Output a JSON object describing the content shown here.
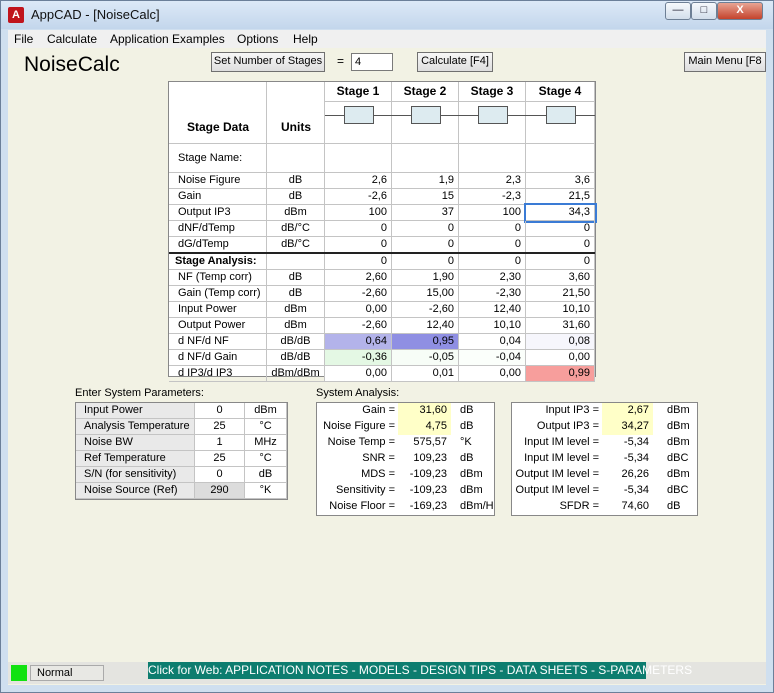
{
  "window": {
    "title": "AppCAD - [NoiseCalc]",
    "minimize": "—",
    "maximize": "□",
    "close": "X"
  },
  "menu": [
    "File",
    "Calculate",
    "Application Examples",
    "Options",
    "Help"
  ],
  "app": {
    "title": "NoiseCalc",
    "set_stages_label": "Set Number of Stages",
    "equals": "=",
    "stages_value": "4",
    "calculate_label": "Calculate [F4]",
    "main_menu_label": "Main Menu [F8"
  },
  "table": {
    "header_label": "Stage Data",
    "units_header": "Units",
    "stages": [
      "Stage  1",
      "Stage  2",
      "Stage  3",
      "Stage  4"
    ],
    "stage_name_label": "Stage Name:",
    "input_rows": [
      {
        "label": "Noise Figure",
        "unit": "dB",
        "values": [
          "2,6",
          "1,9",
          "2,3",
          "3,6"
        ]
      },
      {
        "label": "Gain",
        "unit": "dB",
        "values": [
          "-2,6",
          "15",
          "-2,3",
          "21,5"
        ]
      },
      {
        "label": "Output IP3",
        "unit": "dBm",
        "values": [
          "100",
          "37",
          "100",
          "34,3"
        ]
      },
      {
        "label": "dNF/dTemp",
        "unit": "dB/°C",
        "values": [
          "0",
          "0",
          "0",
          "0"
        ]
      },
      {
        "label": "dG/dTemp",
        "unit": "dB/°C",
        "values": [
          "0",
          "0",
          "0",
          "0"
        ]
      }
    ],
    "analysis_label": "Stage Analysis:",
    "analysis_values": [
      "0",
      "0",
      "0",
      "0"
    ],
    "analysis_rows": [
      {
        "label": "NF (Temp corr)",
        "unit": "dB",
        "values": [
          "2,60",
          "1,90",
          "2,30",
          "3,60"
        ]
      },
      {
        "label": "Gain (Temp corr)",
        "unit": "dB",
        "values": [
          "-2,60",
          "15,00",
          "-2,30",
          "21,50"
        ]
      },
      {
        "label": "Input Power",
        "unit": "dBm",
        "values": [
          "0,00",
          "-2,60",
          "12,40",
          "10,10"
        ]
      },
      {
        "label": "Output Power",
        "unit": "dBm",
        "values": [
          "-2,60",
          "12,40",
          "10,10",
          "31,60"
        ]
      },
      {
        "label": "d NF/d NF",
        "unit": "dB/dB",
        "values": [
          "0,64",
          "0,95",
          "0,04",
          "0,08"
        ]
      },
      {
        "label": "d NF/d Gain",
        "unit": "dB/dB",
        "values": [
          "-0,36",
          "-0,05",
          "-0,04",
          "0,00"
        ]
      },
      {
        "label": "d IP3/d IP3",
        "unit": "dBm/dBm",
        "values": [
          "0,00",
          "0,01",
          "0,00",
          "0,99"
        ]
      }
    ],
    "colors": {
      "nf_nf": [
        "#b3b3ea",
        "#8f8fe3",
        "#ffffff",
        "#f6f6fc"
      ],
      "nf_gain": [
        "#e4f8e4",
        "#f7fdf7",
        "#fbfffb",
        "#ffffff"
      ],
      "ip3": [
        "#ffffff",
        "#ffffff",
        "#ffffff",
        "#f79e9c"
      ]
    }
  },
  "system_params": {
    "title": "Enter System Parameters:",
    "rows": [
      {
        "label": "Input Power",
        "value": "0",
        "unit": "dBm"
      },
      {
        "label": "Analysis Temperature",
        "value": "25",
        "unit": "°C"
      },
      {
        "label": "Noise BW",
        "value": "1",
        "unit": "MHz"
      },
      {
        "label": "Ref Temperature",
        "value": "25",
        "unit": "°C"
      },
      {
        "label": "S/N (for sensitivity)",
        "value": "0",
        "unit": "dB"
      },
      {
        "label": "Noise Source (Ref)",
        "value": "290",
        "unit": "°K"
      }
    ]
  },
  "system_analysis": {
    "title": "System Analysis:",
    "left_rows": [
      {
        "label": "Gain =",
        "value": "31,60",
        "unit": "dB"
      },
      {
        "label": "Noise Figure =",
        "value": "4,75",
        "unit": "dB"
      },
      {
        "label": "Noise Temp =",
        "value": "575,57",
        "unit": "°K"
      },
      {
        "label": "SNR =",
        "value": "109,23",
        "unit": "dB"
      },
      {
        "label": "MDS =",
        "value": "-109,23",
        "unit": "dBm"
      },
      {
        "label": "Sensitivity =",
        "value": "-109,23",
        "unit": "dBm"
      },
      {
        "label": "Noise Floor =",
        "value": "-169,23",
        "unit": "dBm/Hz"
      }
    ],
    "right_rows": [
      {
        "label": "Input IP3 =",
        "value": "2,67",
        "unit": "dBm"
      },
      {
        "label": "Output IP3 =",
        "value": "34,27",
        "unit": "dBm"
      },
      {
        "label": "Input IM level =",
        "value": "-5,34",
        "unit": "dBm"
      },
      {
        "label": "Input IM level =",
        "value": "-5,34",
        "unit": "dBC"
      },
      {
        "label": "Output IM level =",
        "value": "26,26",
        "unit": "dBm"
      },
      {
        "label": "Output IM level =",
        "value": "-5,34",
        "unit": "dBC"
      },
      {
        "label": "SFDR =",
        "value": "74,60",
        "unit": "dB"
      }
    ],
    "highlight_color": "#ffffc8"
  },
  "status": {
    "mode": "Normal",
    "weblink": "Click for Web: APPLICATION NOTES - MODELS - DESIGN TIPS - DATA SHEETS - S-PARAMETERS"
  }
}
